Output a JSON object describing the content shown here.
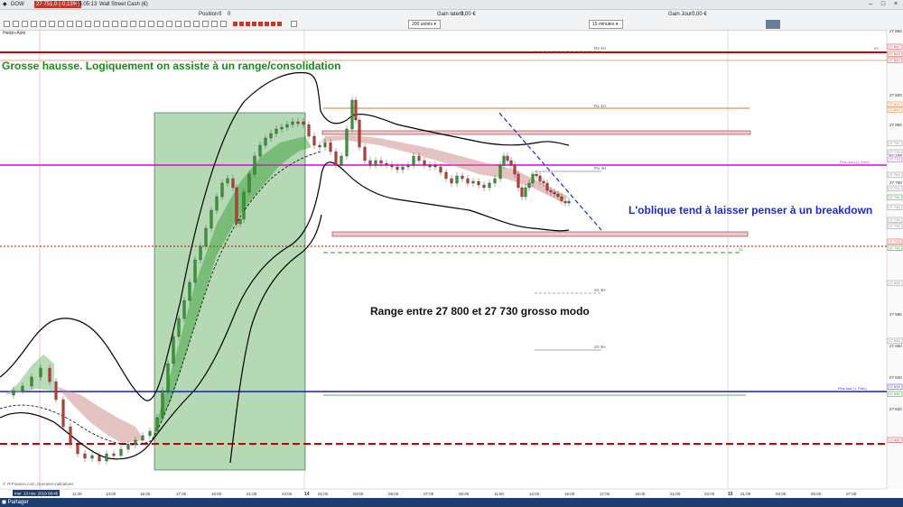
{
  "window": {
    "symbol": "DOW",
    "price": "27 751,0 (-0,13%)",
    "time": "15:05:13",
    "market": "Wall Street Cash (€)"
  },
  "toolbar": {
    "position_label": "Position :",
    "position_value": "0",
    "pending_label": "0",
    "gain_latent_label": "Gain latent :",
    "gain_latent_value": "0,00 €",
    "gain_jour_label": "Gain Jour :",
    "gain_jour_value": "0,00 €",
    "units_select": "200 unités",
    "timeframe_select": "15 minutes"
  },
  "indicator_label": "Heikin-Ashi",
  "annotations": {
    "top_left": "Grosse hausse. Logiquement on assiste à un range/consolidation",
    "right": "L'oblique tend à laisser penser à un breakdown",
    "middle": "Range entre 27 800 et 27 730 grosso modo"
  },
  "colors": {
    "annotation_green": "#1a8a1a",
    "annotation_blue": "#1a2ccf",
    "bull_candle": "#2e9a2e",
    "bear_candle": "#c0392b",
    "resistance_red": "#cc0000",
    "support_magenta": "#e000e0",
    "support_blue": "#1a1acc",
    "statusbar": "#1e3d6e"
  },
  "price_axis": [
    "27 860",
    "27 820",
    "27 800",
    "27 780",
    "27 760",
    "27 740",
    "27 720",
    "27 700",
    "27 680",
    "27 660",
    "27 640",
    "27 620",
    "27 600"
  ],
  "time_axis": [
    "11:00",
    "13:00",
    "15:00",
    "17:00",
    "19:00",
    "21:00",
    "23:00",
    "14",
    "01:00",
    "03:00",
    "05:00",
    "07:00",
    "09:00",
    "11:00",
    "13:00",
    "15:00",
    "17:00",
    "19:00",
    "21:00",
    "23:00",
    "15",
    "01:00",
    "03:00",
    "05:00",
    "07:00"
  ],
  "date_label": "mer. 13 nov. 2019 08:45",
  "copyright": "© IT-Finance.com, Données indicatives",
  "level_labels": [
    "R2 4H",
    "R1 4H",
    "Piv 4H",
    "S2 4H",
    "S3 4H",
    "R1",
    "S1",
    "Plus haut (J. Préc)",
    "Plus bas (J. Préc)"
  ],
  "price_tags": [
    "27 847",
    "27 845",
    "27 840",
    "27 815",
    "27 810",
    "27 787",
    "27 775",
    "27 770",
    "27 761",
    "27 752",
    "27 751",
    "27 745",
    "27 735",
    "27 730",
    "27 723",
    "27 720",
    "27 698",
    "27 655",
    "27 634",
    "27 630",
    "27 600"
  ],
  "statusbar": {
    "share_label": "Partager"
  }
}
